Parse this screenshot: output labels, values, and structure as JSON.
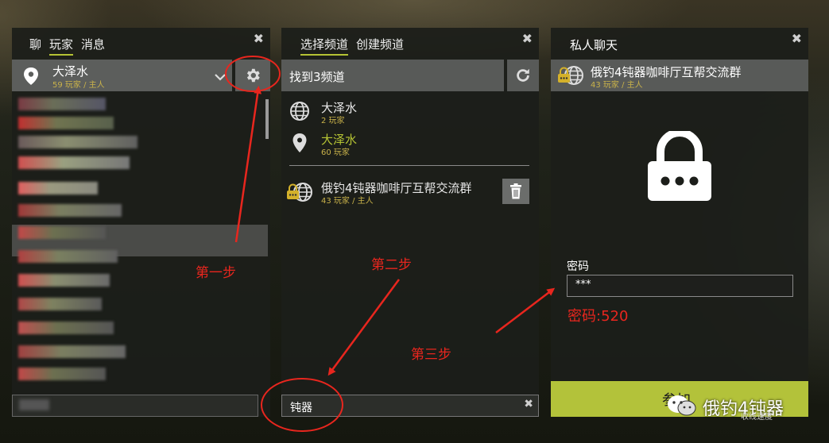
{
  "left_panel": {
    "tabs": [
      "聊",
      "玩家",
      "消息"
    ],
    "active_tab": 1,
    "close": "✖",
    "location": {
      "name": "大泽水",
      "sub": "59 玩家 / 主人"
    }
  },
  "mid_panel": {
    "tabs": [
      "选择频道",
      "创建频道"
    ],
    "active_tab": 0,
    "close": "✖",
    "header": "找到3频道",
    "channels": [
      {
        "name": "大泽水",
        "sub": "2 玩家",
        "icon": "globe-icon",
        "highlight": false
      },
      {
        "name": "大泽水",
        "sub": "60 玩家",
        "icon": "pin-icon",
        "highlight": true
      },
      {
        "name": "俄钓4钝器咖啡厅互帮交流群",
        "sub": "43 玩家 / 主人",
        "icon": "locked-globe-icon",
        "highlight": false
      }
    ],
    "search_value": "钝器",
    "search_clear": "✖"
  },
  "right_panel": {
    "title": "私人聊天",
    "close": "✖",
    "channel": {
      "name": "俄钓4钝器咖啡厅互帮交流群",
      "sub": "43 玩家 / 主人"
    },
    "password_label": "密码",
    "password_value": "***",
    "join_label": "参加"
  },
  "annotations": {
    "step1": "第一步",
    "step2": "第二步",
    "step3": "第三步",
    "password_hint": "密码:520"
  },
  "watermark": {
    "text": "俄钓4钝器",
    "sub": "收线速度"
  },
  "colors": {
    "accent": "#b3c23a",
    "gold": "#c9b24a",
    "annotation": "#e8261e"
  }
}
